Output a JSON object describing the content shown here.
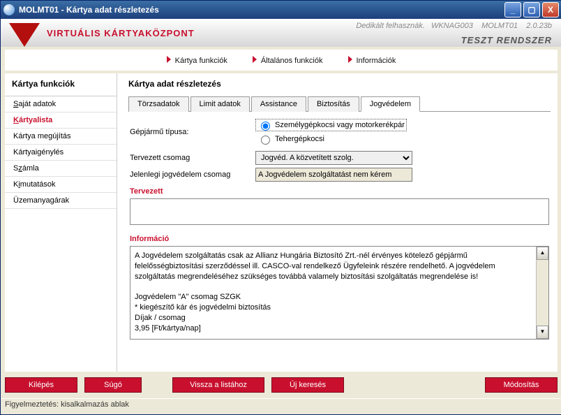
{
  "window": {
    "title": "MOLMT01 - Kártya adat részletezés"
  },
  "banner": {
    "brand": "VIRTUÁLIS KÁRTYAKÖZPONT",
    "user_label": "Dedikált felhasznák.",
    "user": "WKNAG003",
    "app": "MOLMT01",
    "version": "2.0.23b",
    "system": "TESZT RENDSZER"
  },
  "topnav": [
    "Kártya funkciók",
    "Általános funkciók",
    "Információk"
  ],
  "sidebar": {
    "title": "Kártya funkciók",
    "items": [
      {
        "label": "Saját adatok",
        "u": "S"
      },
      {
        "label": "Kártyalista",
        "u": "K",
        "active": true
      },
      {
        "label": "Kártya megújítás",
        "u": ""
      },
      {
        "label": "Kártyaigénylés",
        "u": ""
      },
      {
        "label": "Számla",
        "u": "z"
      },
      {
        "label": "Kimutatások",
        "u": "i"
      },
      {
        "label": "Üzemanyagárak",
        "u": ""
      }
    ]
  },
  "page": {
    "title": "Kártya adat részletezés"
  },
  "tabs": [
    "Törzsadatok",
    "Limit adatok",
    "Assistance",
    "Biztosítás",
    "Jogvédelem"
  ],
  "active_tab": "Jogvédelem",
  "form": {
    "vehicle_label": "Gépjármű típusa:",
    "vehicle_opts": [
      "Személygépkocsi vagy motorkerékpár",
      "Tehergépkocsi"
    ],
    "vehicle_selected": 0,
    "planned_label": "Tervezett csomag",
    "planned_value": "Jogvéd. A közvetített szolg.",
    "current_label": "Jelenlegi jogvédelem csomag",
    "current_value": "A Jogvédelem szolgáltatást nem kérem",
    "planned_section": "Tervezett",
    "info_section": "Információ",
    "info_text": "A Jogvédelem szolgáltatás csak az Allianz Hungária Biztosító Zrt.-nél érvényes kötelező gépjármű felelősségbiztosítási szerződéssel ill. CASCO-val rendelkező Ügyfeleink részére rendelhető. A jogvédelem szolgáltatás megrendeléséhez szükséges továbbá valamely biztosítási szolgáltatás megrendelése is!",
    "info_p2": "Jogvédelem \"A\" csomag SZGK",
    "info_p3": "* kiegészítő kár és jogvédelmi biztosítás",
    "info_p4": "Díjak / csomag",
    "info_p5": "3,95 [Ft/kártya/nap]"
  },
  "buttons": {
    "exit": "Kilépés",
    "help": "Súgó",
    "back": "Vissza a listához",
    "new": "Új keresés",
    "modify": "Módosítás"
  },
  "status": "Figyelmeztetés: kisalkalmazás ablak"
}
